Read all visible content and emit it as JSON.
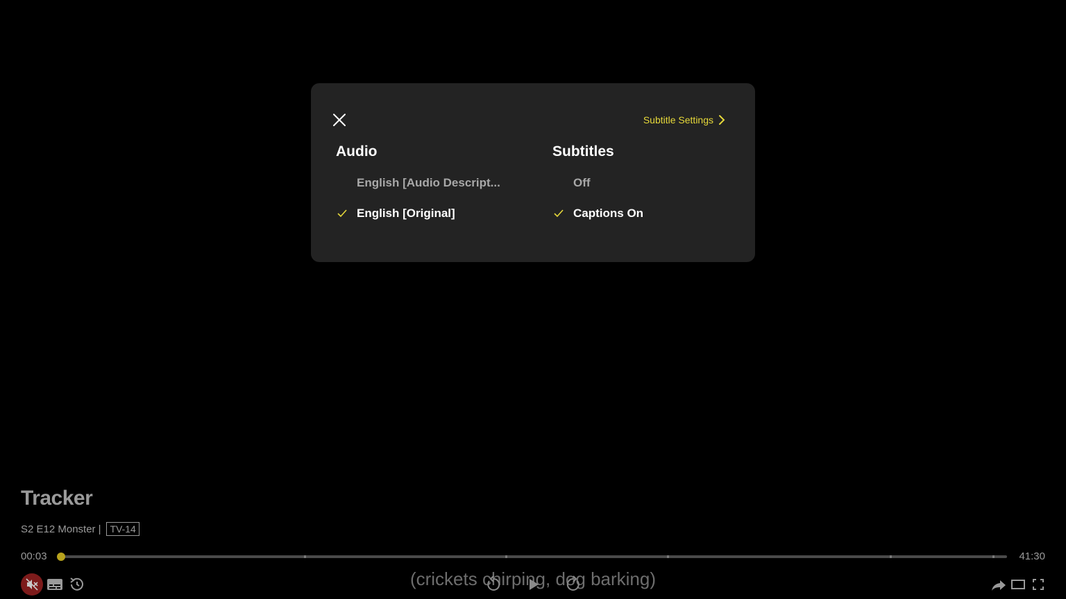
{
  "dialog": {
    "subtitle_settings_label": "Subtitle Settings",
    "audio": {
      "title": "Audio",
      "options": [
        {
          "label": "English [Audio Descript...",
          "selected": false
        },
        {
          "label": "English [Original]",
          "selected": true
        }
      ]
    },
    "subtitles": {
      "title": "Subtitles",
      "options": [
        {
          "label": "Off",
          "selected": false
        },
        {
          "label": "Captions On",
          "selected": true
        }
      ]
    }
  },
  "player": {
    "show_title": "Tracker",
    "episode": "S2 E12 Monster",
    "separator": "|",
    "rating": "TV-14",
    "current_time": "00:03",
    "total_time": "41:30",
    "progress_fraction": 0.0012,
    "caption_text": "(crickets chirping, dog barking)"
  },
  "colors": {
    "accent": "#e6d83a",
    "progress_fill": "#b8a31d",
    "mute_bg": "#7d1b1b",
    "dialog_bg": "#232323"
  },
  "icons": [
    "close-icon",
    "chevron-right-icon",
    "check-icon",
    "mute-icon",
    "subtitles-icon",
    "restart-icon",
    "rewind-10-icon",
    "play-icon",
    "forward-10-icon",
    "share-icon",
    "theater-mode-icon",
    "fullscreen-icon"
  ]
}
